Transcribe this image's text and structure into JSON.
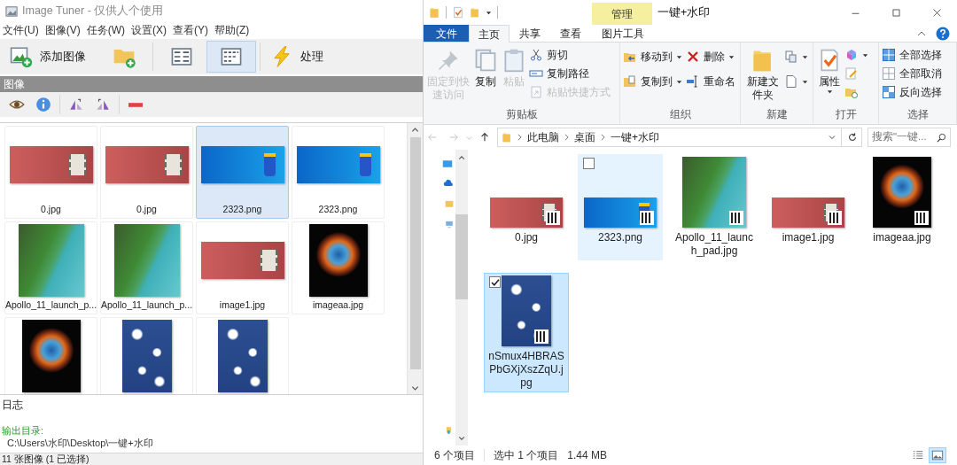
{
  "image_tuner": {
    "title": "Image Tuner - 仅供人个使用",
    "menu": [
      "文件(U)",
      "图像(V)",
      "任务(W)",
      "设置(X)",
      "查看(Y)",
      "帮助(Z)"
    ],
    "toolbar": [
      [
        {
          "kind": "add-image",
          "label": "添加图像",
          "selected": false
        },
        {
          "kind": "add-folder",
          "selected": false
        }
      ],
      [
        {
          "kind": "list-view",
          "selected": false
        },
        {
          "kind": "thumbnail-view",
          "selected": true
        }
      ],
      [
        {
          "kind": "lightning",
          "label": "处理",
          "selected": false
        }
      ]
    ],
    "panel_title": "图像",
    "image_tools": [
      [
        {
          "kind": "eye"
        },
        {
          "kind": "info"
        }
      ],
      [
        {
          "kind": "flip-left"
        },
        {
          "kind": "flip-right"
        }
      ],
      [
        {
          "kind": "remove"
        }
      ]
    ],
    "images": [
      {
        "name": "0.jpg",
        "kind": "red-banner",
        "selected": false
      },
      {
        "name": "0.jpg",
        "kind": "red-banner",
        "selected": false
      },
      {
        "name": "2323.png",
        "kind": "blue-banner",
        "selected": true
      },
      {
        "name": "2323.png",
        "kind": "blue-banner",
        "selected": false
      },
      {
        "name": "Apollo_11_launch_p...",
        "kind": "map",
        "selected": false
      },
      {
        "name": "Apollo_11_launch_p...",
        "kind": "map",
        "selected": false
      },
      {
        "name": "image1.jpg",
        "kind": "red-banner",
        "selected": false
      },
      {
        "name": "imageaa.jpg",
        "kind": "nebula",
        "selected": false
      },
      {
        "kind": "nebula",
        "selected": false
      },
      {
        "kind": "clouds",
        "selected": false
      },
      {
        "kind": "clouds",
        "selected": false
      }
    ],
    "log": {
      "title": "日志",
      "lines": [
        {
          "kind": "heading",
          "text": "输出目录:"
        },
        {
          "kind": "path",
          "text": "C:\\Users\\水印\\Desktop\\一键+水印"
        }
      ]
    },
    "status": "11 张图像 (1 已选择)"
  },
  "explorer": {
    "context_tab": "管理",
    "title": "一键+水印",
    "tabs": [
      {
        "label": "文件",
        "kind": "file",
        "selected": false
      },
      {
        "label": "主页",
        "kind": "tab",
        "selected": true
      },
      {
        "label": "共享",
        "kind": "tab",
        "selected": false
      },
      {
        "label": "查看",
        "kind": "tab",
        "selected": false
      },
      {
        "label": "图片工具",
        "kind": "context",
        "selected": false
      }
    ],
    "ribbon_groups": [
      {
        "label": "剪贴板",
        "controls": [
          {
            "kind": "pin",
            "label": "固定到快速访问",
            "disabled": true,
            "dropdown": false
          },
          {
            "kind": "copy",
            "label": "复制",
            "disabled": false,
            "dropdown": false
          },
          {
            "kind": "clipboard",
            "label": "粘贴",
            "disabled": true,
            "dropdown": false
          },
          {
            "kind": "stack",
            "items": [
              {
                "kind": "scissors",
                "label": "剪切",
                "disabled": false,
                "dropdown": false
              },
              {
                "kind": "path",
                "label": "复制路径",
                "disabled": false,
                "dropdown": false
              },
              {
                "kind": "shortcut",
                "label": "粘贴快捷方式",
                "disabled": true,
                "dropdown": false
              }
            ]
          }
        ]
      },
      {
        "label": "组织",
        "controls": [
          {
            "kind": "stack",
            "items": [
              {
                "kind": "move",
                "label": "移动到",
                "disabled": false,
                "dropdown": true
              },
              {
                "kind": "copy-to",
                "label": "复制到",
                "disabled": false,
                "dropdown": true
              }
            ]
          },
          {
            "kind": "stack",
            "items": [
              {
                "kind": "delete",
                "label": "删除",
                "disabled": false,
                "dropdown": true
              },
              {
                "kind": "rename",
                "label": "重命名",
                "disabled": false,
                "dropdown": false
              }
            ]
          }
        ]
      },
      {
        "label": "新建",
        "controls": [
          {
            "kind": "folder-big",
            "label": "新建文件夹",
            "disabled": false,
            "dropdown": false
          },
          {
            "kind": "stack",
            "items": [
              {
                "kind": "new-item",
                "disabled": false,
                "dropdown": true
              },
              {
                "kind": "easy-access",
                "disabled": false,
                "dropdown": true
              }
            ]
          }
        ]
      },
      {
        "label": "打开",
        "controls": [
          {
            "kind": "properties",
            "label": "属性",
            "disabled": false,
            "dropdown": true
          },
          {
            "kind": "stack",
            "items": [
              {
                "kind": "open",
                "disabled": false,
                "dropdown": true
              },
              {
                "kind": "edit",
                "disabled": false,
                "dropdown": false
              },
              {
                "kind": "history",
                "disabled": false,
                "dropdown": false
              }
            ]
          }
        ]
      },
      {
        "label": "选择",
        "controls": [
          {
            "kind": "stack",
            "items": [
              {
                "kind": "select-all",
                "label": "全部选择",
                "disabled": false,
                "dropdown": false
              },
              {
                "kind": "select-none",
                "label": "全部取消",
                "disabled": false,
                "dropdown": false
              },
              {
                "kind": "invert",
                "label": "反向选择",
                "disabled": false,
                "dropdown": false
              }
            ]
          }
        ]
      }
    ],
    "crumbs": [
      "此电脑",
      "桌面",
      "一键+水印"
    ],
    "search_placeholder": "搜索\"一键...",
    "items": [
      {
        "name": "0.jpg",
        "kind": "red-banner",
        "selected": false,
        "hovered": false,
        "checked": false
      },
      {
        "name": "2323.png",
        "kind": "blue-banner",
        "selected": false,
        "hovered": true,
        "checked": false
      },
      {
        "name": "Apollo_11_launch_pad.jpg",
        "kind": "map",
        "selected": false,
        "hovered": false,
        "checked": false
      },
      {
        "name": "image1.jpg",
        "kind": "red-banner",
        "selected": false,
        "hovered": false,
        "checked": false
      },
      {
        "name": "imageaa.jpg",
        "kind": "nebula",
        "selected": false,
        "hovered": false,
        "checked": false
      },
      {
        "name": "nSmux4HBRASPbGXjXszZqU.jpg",
        "kind": "clouds",
        "selected": true,
        "hovered": false,
        "checked": true
      }
    ],
    "status": {
      "count": "6 个项目",
      "selection": "选中 1 个项目",
      "size": "1.44 MB"
    },
    "views": [
      {
        "kind": "details",
        "selected": false
      },
      {
        "kind": "large-icons",
        "selected": true
      }
    ]
  }
}
